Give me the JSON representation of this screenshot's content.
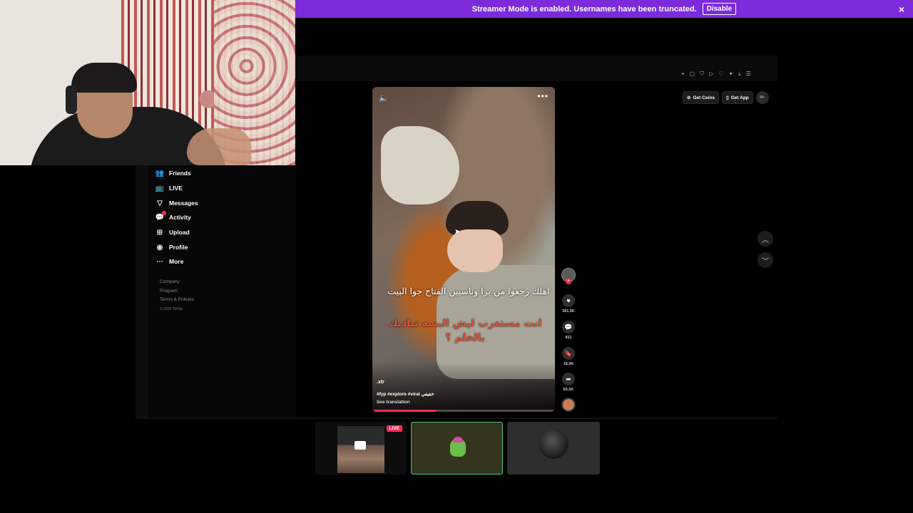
{
  "banner": {
    "message": "Streamer Mode is enabled. Usernames have been truncated.",
    "disable_label": "Disable",
    "close_icon": "×"
  },
  "sidebar": {
    "items": [
      {
        "label": "Friends",
        "icon": "friends-icon",
        "glyph": "👥"
      },
      {
        "label": "LIVE",
        "icon": "live-icon",
        "glyph": "📺"
      },
      {
        "label": "Messages",
        "icon": "messages-icon",
        "glyph": "▽"
      },
      {
        "label": "Activity",
        "icon": "activity-icon",
        "glyph": "💬"
      },
      {
        "label": "Upload",
        "icon": "upload-icon",
        "glyph": "⊞"
      },
      {
        "label": "Profile",
        "icon": "profile-icon",
        "glyph": "◉"
      },
      {
        "label": "More",
        "icon": "more-icon",
        "glyph": "⋯"
      }
    ],
    "footer": {
      "company": "Company",
      "program": "Program",
      "terms": "Terms & Policies",
      "copyright": "© 2026 TikTok"
    }
  },
  "video": {
    "caption_line1": "اهلك رجعوا من برا وناسيين الفتاح جوا البيت",
    "caption_line2": "انت مستغرب ليش البسه تناديك بالحلم ؟",
    "username": ".xtr",
    "hashtags": "#fyp #explore #viral خفيفي",
    "see_translation": "See translation",
    "progress": 0.35
  },
  "actions": {
    "likes": "391.5K",
    "comments": "811",
    "saves": "18.9K",
    "shares": "65.5K"
  },
  "top_right": {
    "get_coins": "Get Coins",
    "get_app": "Get App",
    "avatar_text": "M+"
  },
  "bottom": {
    "live_badge": "LIVE"
  },
  "colors": {
    "banner": "#7c2bdc",
    "accent": "#fe2c55",
    "selected_border": "#4fc37c"
  }
}
